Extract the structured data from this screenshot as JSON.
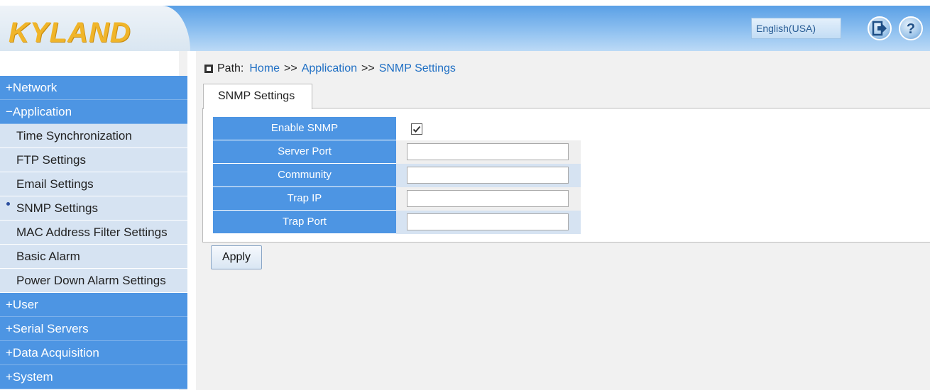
{
  "header": {
    "logo_text": "KYLAND",
    "language": "English(USA)",
    "logout_icon": "logout-arrow-icon",
    "help_icon": "help-question-icon"
  },
  "sidebar": {
    "items": [
      {
        "label": "+Network",
        "type": "top"
      },
      {
        "label": "−Application",
        "type": "top"
      },
      {
        "label": "Time Synchronization",
        "type": "sub"
      },
      {
        "label": "FTP Settings",
        "type": "sub"
      },
      {
        "label": "Email Settings",
        "type": "sub"
      },
      {
        "label": "SNMP Settings",
        "type": "sub",
        "active": true
      },
      {
        "label": "MAC Address Filter Settings",
        "type": "sub"
      },
      {
        "label": "Basic Alarm",
        "type": "sub"
      },
      {
        "label": "Power Down Alarm Settings",
        "type": "sub"
      },
      {
        "label": "+User",
        "type": "top"
      },
      {
        "label": "+Serial Servers",
        "type": "top"
      },
      {
        "label": "+Data Acquisition",
        "type": "top"
      },
      {
        "label": "+System",
        "type": "top"
      }
    ]
  },
  "breadcrumb": {
    "prefix": "Path:",
    "home": "Home",
    "sep": ">>",
    "section": "Application",
    "page": "SNMP Settings"
  },
  "tab": {
    "label": "SNMP Settings"
  },
  "form": {
    "enable_snmp_label": "Enable SNMP",
    "enable_snmp_checked": true,
    "server_port_label": "Server Port",
    "server_port_value": "",
    "community_label": "Community",
    "community_value": "",
    "trap_ip_label": "Trap IP",
    "trap_ip_value": "",
    "trap_port_label": "Trap Port",
    "trap_port_value": ""
  },
  "apply_label": "Apply",
  "colors": {
    "menu_blue": "#4d95e3",
    "submenu_bg": "#d6e3f2",
    "link_blue": "#1f6fc4",
    "logo_gold": "#f0b52a"
  }
}
